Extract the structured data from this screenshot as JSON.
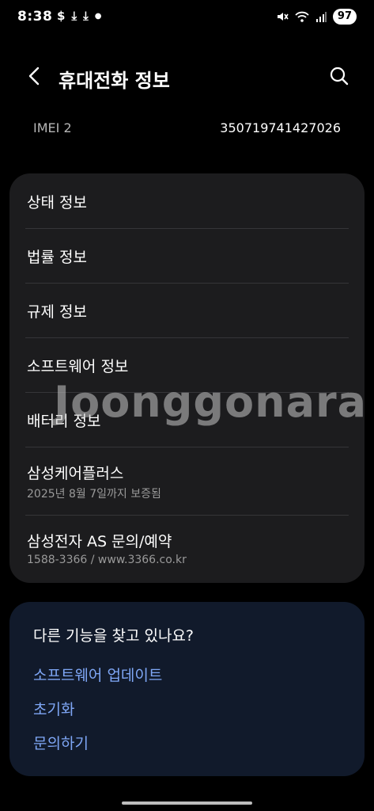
{
  "status_bar": {
    "time": "8:38",
    "left_icons": [
      "s-money-icon",
      "download-icon",
      "download-icon",
      "dot-icon"
    ],
    "right_icons": [
      "mute-icon",
      "wifi-icon",
      "signal-icon"
    ],
    "battery": "97"
  },
  "header": {
    "title": "휴대전화 정보"
  },
  "imei": {
    "label": "IMEI 2",
    "value": "350719741427026"
  },
  "info_items": [
    {
      "label": "상태 정보"
    },
    {
      "label": "법률 정보"
    },
    {
      "label": "규제 정보"
    },
    {
      "label": "소프트웨어 정보"
    },
    {
      "label": "배터리 정보"
    },
    {
      "label": "삼성케어플러스",
      "sub": "2025년 8월 7일까지 보증됨"
    },
    {
      "label": "삼성전자 AS 문의/예약",
      "sub": "1588-3366 / www.3366.co.kr"
    }
  ],
  "suggest": {
    "title": "다른 기능을 찾고 있나요?",
    "links": [
      "소프트웨어 업데이트",
      "초기화",
      "문의하기"
    ]
  },
  "watermark": "Joonggonara",
  "colors": {
    "background": "#000000",
    "card": "#1c1c1e",
    "suggest_card": "#111a2b",
    "link": "#7fa7f6"
  }
}
